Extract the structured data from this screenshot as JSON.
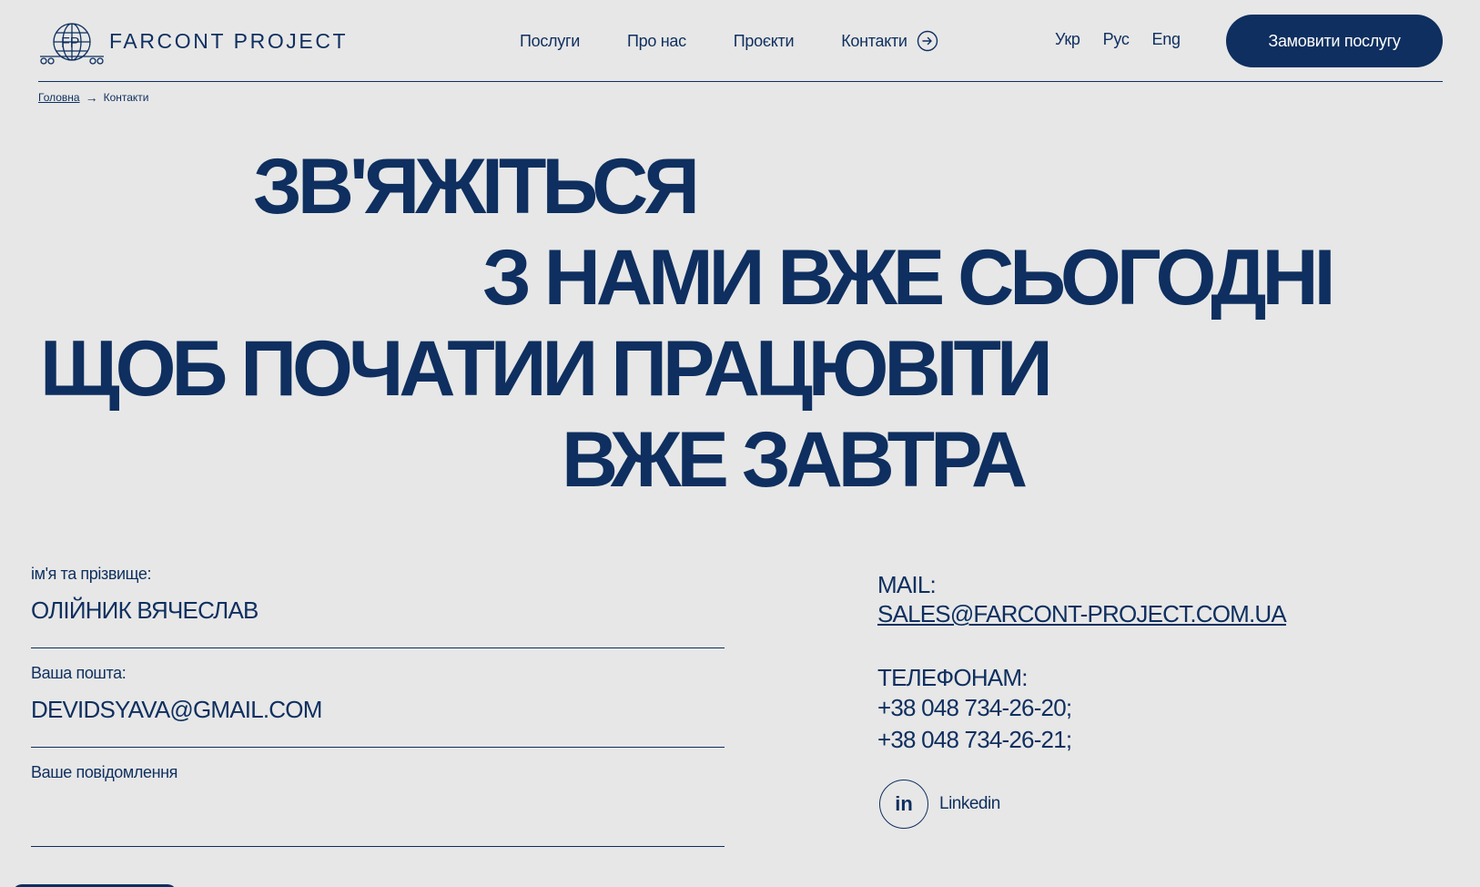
{
  "brand": {
    "name": "FARCONT PROJECT",
    "color": "#0e2f5f",
    "background": "#e7e7e7"
  },
  "nav": {
    "services": "Послуги",
    "about": "Про нас",
    "projects": "Проєкти",
    "contacts": "Контакти"
  },
  "langs": {
    "ukr": "Укр",
    "rus": "Рус",
    "eng": "Eng"
  },
  "order_button": "Замовити послугу",
  "breadcrumb": {
    "home": "Головна",
    "arrow": "→",
    "current": "Контакти"
  },
  "hero": {
    "line1": "ЗВ'ЯЖІТЬСЯ",
    "line2": "З НАМИ ВЖЕ СЬОГОДНІ",
    "line3": "ЩОБ ПОЧАТИИ ПРАЦЮВІТИ",
    "line4": "ВЖЕ ЗАВТРА"
  },
  "form": {
    "name_label": "ім'я та прізвище:",
    "name_value": "ОЛІЙНИК ВЯЧЕСЛАВ",
    "email_label": "Ваша пошта:",
    "email_value": "DEVIDSYAVA@GMAIL.COM",
    "message_label": "Ваше повідомлення",
    "message_value": ""
  },
  "contacts": {
    "mail_label": "MAIL:",
    "mail_value": "SALES@FARCONT-PROJECT.COM.UA",
    "phones_label": "ТЕЛЕФОНАМ:",
    "phone1": "+38 048 734-26-20;",
    "phone2": "+38 048 734-26-21;",
    "linkedin_icon_text": "in",
    "linkedin_label": "Linkedin"
  }
}
